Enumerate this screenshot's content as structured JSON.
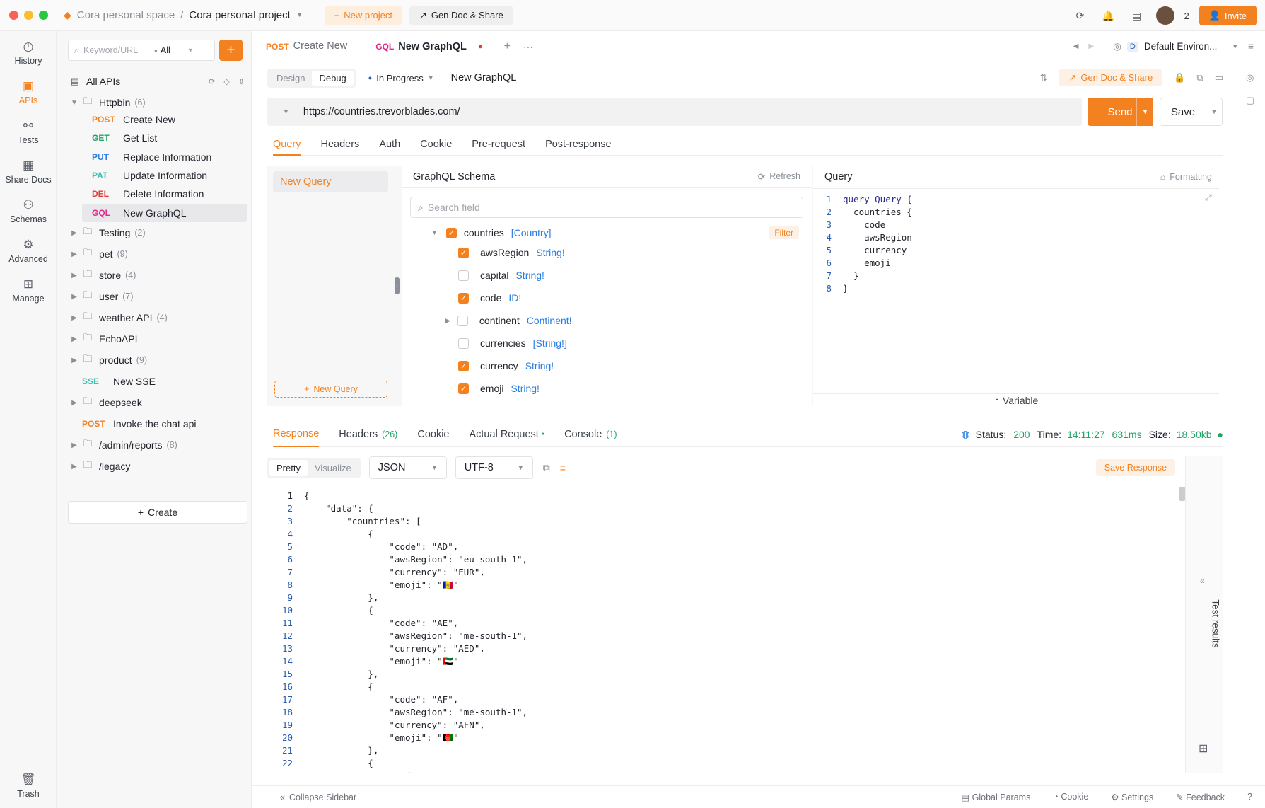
{
  "window": {
    "workspace": "Cora personal space",
    "project": "Cora personal project",
    "new_project": "New project",
    "gen_doc": "Gen Doc & Share",
    "notif_count": "2",
    "invite": "Invite"
  },
  "rail": {
    "history": "History",
    "apis": "APIs",
    "tests": "Tests",
    "share_docs": "Share Docs",
    "schemas": "Schemas",
    "advanced": "Advanced",
    "manage": "Manage",
    "trash": "Trash"
  },
  "sidebar": {
    "search_placeholder": "Keyword/URL",
    "filter": "All",
    "all_apis": "All APIs",
    "httpbin": {
      "name": "Httpbin",
      "count": "(6)"
    },
    "endpoints": [
      {
        "method": "POST",
        "name": "Create New",
        "color": "#f4811f"
      },
      {
        "method": "GET",
        "name": "Get List",
        "color": "#21a366"
      },
      {
        "method": "PUT",
        "name": "Replace Information",
        "color": "#2a7de1"
      },
      {
        "method": "PAT",
        "name": "Update Information",
        "color": "#3fbfae"
      },
      {
        "method": "DEL",
        "name": "Delete Information",
        "color": "#e23c3c"
      },
      {
        "method": "GQL",
        "name": "New GraphQL",
        "color": "#e0288d"
      }
    ],
    "folders": [
      {
        "name": "Testing",
        "count": "(2)"
      },
      {
        "name": "pet",
        "count": "(9)"
      },
      {
        "name": "store",
        "count": "(4)"
      },
      {
        "name": "user",
        "count": "(7)"
      },
      {
        "name": "weather API",
        "count": "(4)"
      },
      {
        "name": "EchoAPI",
        "count": ""
      },
      {
        "name": "product",
        "count": "(9)"
      }
    ],
    "sse": {
      "method": "SSE",
      "name": "New SSE"
    },
    "deepseek": "deepseek",
    "invoke": {
      "method": "POST",
      "name": "Invoke the chat api"
    },
    "admin_reports": {
      "name": "/admin/reports",
      "count": "(8)"
    },
    "legacy": "/legacy",
    "create": "Create"
  },
  "tabs": {
    "tab1_method": "POST",
    "tab1_name": "Create New",
    "tab2_method": "GQL",
    "tab2_name": "New GraphQL",
    "env": "Default Environ..."
  },
  "request": {
    "design": "Design",
    "debug": "Debug",
    "status": "In Progress",
    "name": "New GraphQL",
    "gen_doc": "Gen Doc & Share",
    "url": "https://countries.trevorblades.com/",
    "send": "Send",
    "save": "Save",
    "subtabs": [
      "Query",
      "Headers",
      "Auth",
      "Cookie",
      "Pre-request",
      "Post-response"
    ]
  },
  "graphql": {
    "query_list_item": "New Query",
    "new_query": "New Query",
    "schema_title": "GraphQL Schema",
    "refresh": "Refresh",
    "search_placeholder": "Search field",
    "root": {
      "name": "countries",
      "type": "[Country]",
      "filter": "Filter"
    },
    "fields": [
      {
        "name": "awsRegion",
        "type": "String!",
        "checked": true
      },
      {
        "name": "capital",
        "type": "String!",
        "checked": false
      },
      {
        "name": "code",
        "type": "ID!",
        "checked": true
      },
      {
        "name": "continent",
        "type": "Continent!",
        "checked": false
      },
      {
        "name": "currencies",
        "type": "[String!]",
        "checked": false
      },
      {
        "name": "currency",
        "type": "String!",
        "checked": true
      },
      {
        "name": "emoji",
        "type": "String!",
        "checked": true
      }
    ],
    "query_title": "Query",
    "formatting": "Formatting",
    "query_lines": [
      "query Query {",
      "  countries {",
      "    code",
      "    awsRegion",
      "    currency",
      "    emoji",
      "  }",
      "}"
    ],
    "variable": "Variable"
  },
  "response": {
    "tabs": {
      "response": "Response",
      "headers": "Headers",
      "headers_count": "(26)",
      "cookie": "Cookie",
      "actual": "Actual Request",
      "console": "Console",
      "console_count": "(1)"
    },
    "status_label": "Status:",
    "status": "200",
    "time_label": "Time:",
    "time": "14:11:27",
    "duration": "631ms",
    "size_label": "Size:",
    "size": "18.50kb",
    "pretty": "Pretty",
    "visualize": "Visualize",
    "format": "JSON",
    "encoding": "UTF-8",
    "save_response": "Save Response",
    "test_results": "Test results",
    "lines": [
      "{",
      "    \"data\": {",
      "        \"countries\": [",
      "            {",
      "                \"code\": \"AD\",",
      "                \"awsRegion\": \"eu-south-1\",",
      "                \"currency\": \"EUR\",",
      "                \"emoji\": \"🇦🇩\"",
      "            },",
      "            {",
      "                \"code\": \"AE\",",
      "                \"awsRegion\": \"me-south-1\",",
      "                \"currency\": \"AED\",",
      "                \"emoji\": \"🇦🇪\"",
      "            },",
      "            {",
      "                \"code\": \"AF\",",
      "                \"awsRegion\": \"me-south-1\",",
      "                \"currency\": \"AFN\",",
      "                \"emoji\": \"🇦🇫\"",
      "            },",
      "            {",
      "                \"code\": \"AG\","
    ]
  },
  "footer": {
    "collapse": "Collapse Sidebar",
    "global_params": "Global Params",
    "cookie": "Cookie",
    "settings": "Settings",
    "feedback": "Feedback"
  }
}
